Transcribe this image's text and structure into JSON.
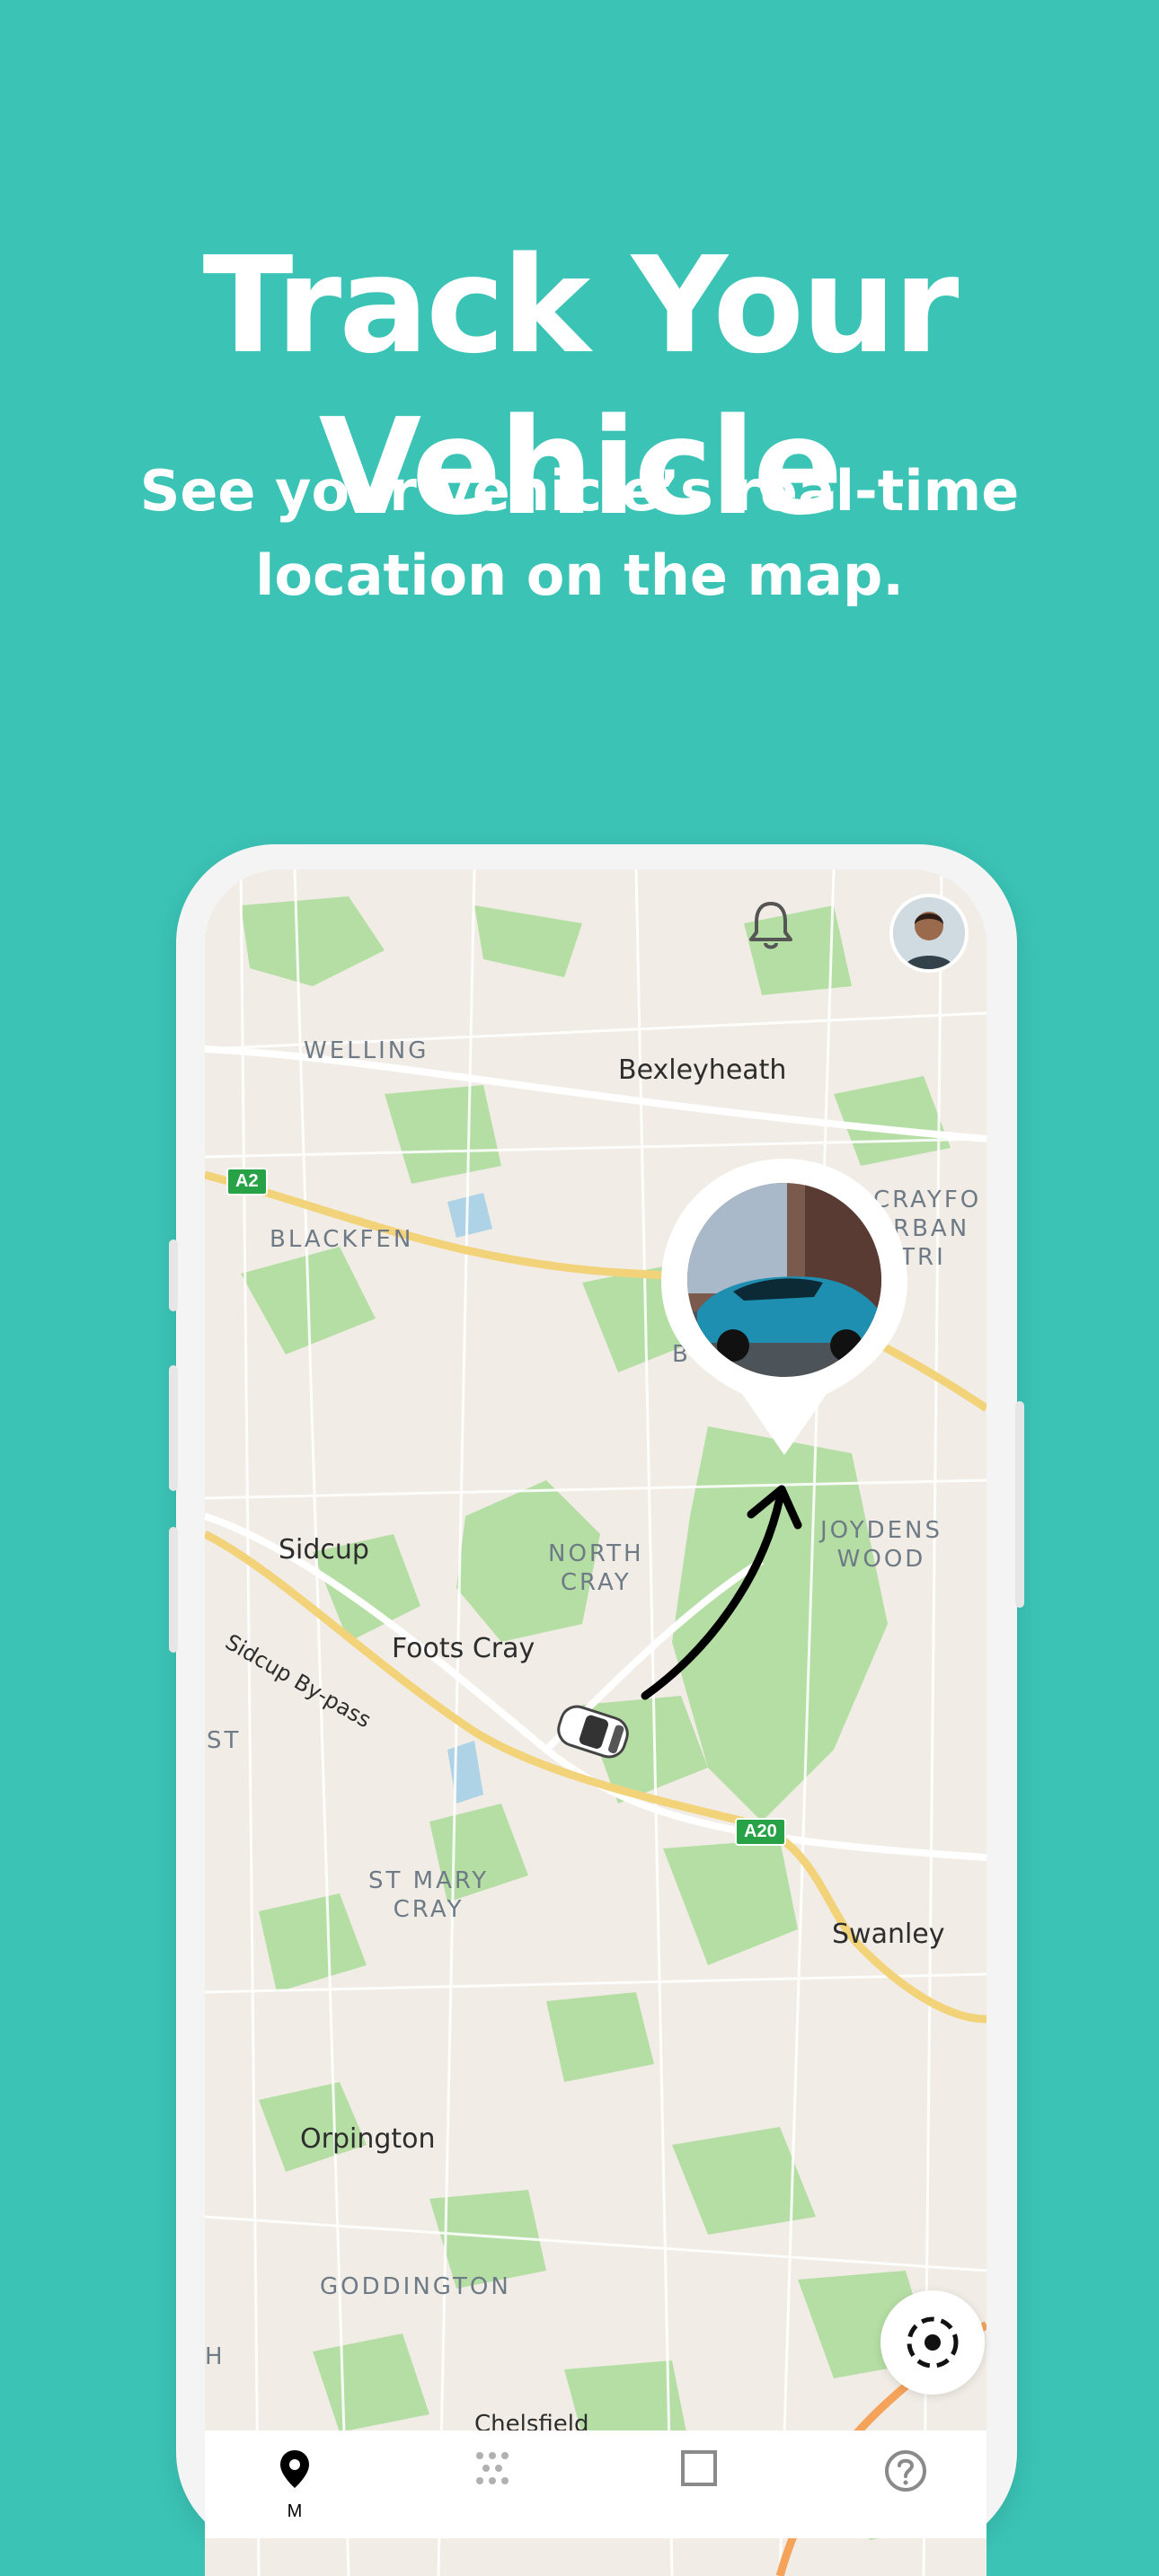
{
  "promo": {
    "headline": "Track Your Vehicle",
    "subtitle_line1": "See your vehicle’s real-time",
    "subtitle_line2": "location on the map."
  },
  "colors": {
    "background": "#3bc4b6",
    "map_green": "#b5dea4",
    "road_yellow": "#f2d37a",
    "road_orange": "#f5a25a"
  },
  "map": {
    "places": [
      {
        "name": "Bexleyheath"
      },
      {
        "name": "Sidcup"
      },
      {
        "name": "Foots Cray"
      },
      {
        "name": "Swanley"
      },
      {
        "name": "Orpington"
      },
      {
        "name": "Chelsfield"
      }
    ],
    "districts": {
      "welling": "WELLING",
      "blackfen": "BLACKFEN",
      "north_cray": "NORTH\nCRAY",
      "st_mary_cray": "ST MARY\nCRAY",
      "goddington": "GODDINGTON",
      "joydens_wood": "JOYDENS\nWOOD",
      "crayford": "CRAYFO\nURBAN\nISTRI",
      "st": "ST",
      "h": "H",
      "b": "B"
    },
    "roads": {
      "a2": "A2",
      "a20": "A20",
      "sidcup_bypass": "Sidcup By-pass"
    }
  },
  "icons": {
    "notifications": "bell-icon",
    "recenter": "recenter-icon",
    "vehicle": "car-icon",
    "pin": "vehicle-location-pin"
  },
  "tabs": [
    {
      "icon": "map-pin-icon",
      "label": "M",
      "active": true
    },
    {
      "icon": "grid-dots-icon",
      "label": "",
      "active": false
    },
    {
      "icon": "square-icon",
      "label": "",
      "active": false
    },
    {
      "icon": "help-icon",
      "label": "",
      "active": false
    }
  ]
}
